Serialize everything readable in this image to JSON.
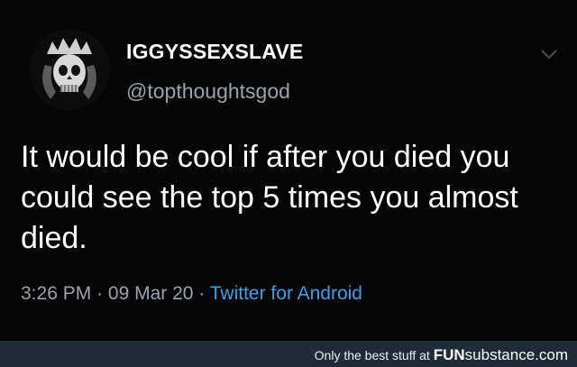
{
  "tweet": {
    "avatar_icon": "skull-crown-avatar-icon",
    "display_name": "IGGYSSEXSLAVE",
    "handle": "@topthoughtsgod",
    "menu_icon": "chevron-down-icon",
    "text": "It would be cool if after you died you could see the top 5 times you almost died.",
    "time": "3:26 PM",
    "date": "09 Mar 20",
    "separator": "·",
    "source": "Twitter for Android"
  },
  "footer": {
    "caption": "Only the best stuff at ",
    "brand_prefix": "FUN",
    "brand_mid": "substance",
    "brand_suffix": ".com"
  },
  "colors": {
    "background": "#050505",
    "text": "#ffffff",
    "muted": "#9aa3ad",
    "link": "#3aa0e8",
    "footer_bg": "#1f2c36"
  }
}
